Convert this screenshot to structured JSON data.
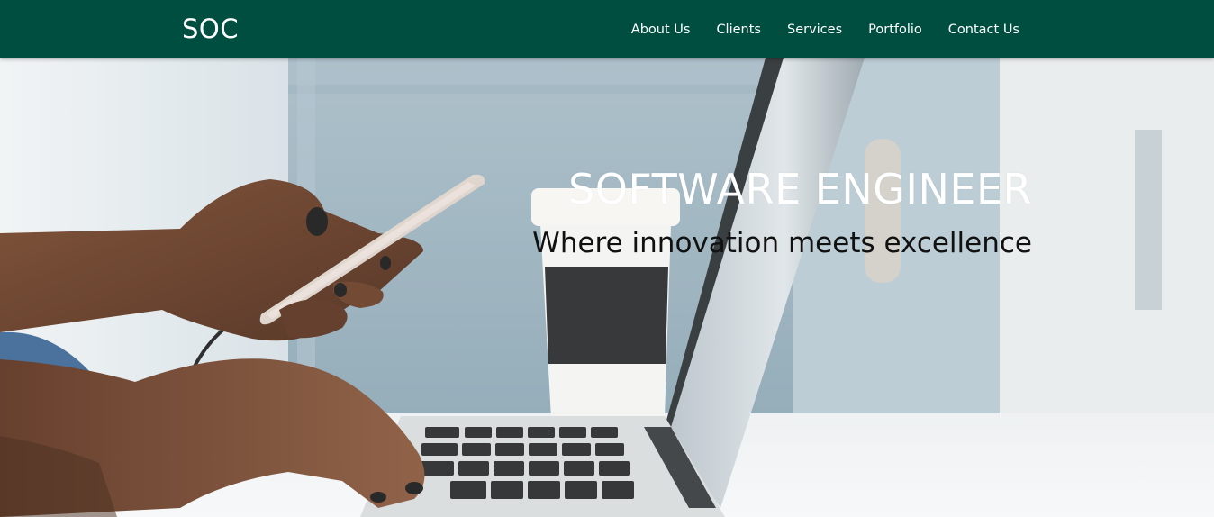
{
  "nav": {
    "brand": "SOC",
    "links": [
      {
        "label": "About Us"
      },
      {
        "label": "Clients"
      },
      {
        "label": "Services"
      },
      {
        "label": "Portfolio"
      },
      {
        "label": "Contact Us"
      }
    ]
  },
  "hero": {
    "title": "SOFTWARE ENGINEER",
    "subtitle": "Where innovation meets excellence",
    "image_alt": "person typing on laptop holding phone with coffee cup"
  },
  "colors": {
    "navbar": "#004e40",
    "nav_text": "#ffffff",
    "title": "#ffffff",
    "subtitle": "#111111"
  }
}
